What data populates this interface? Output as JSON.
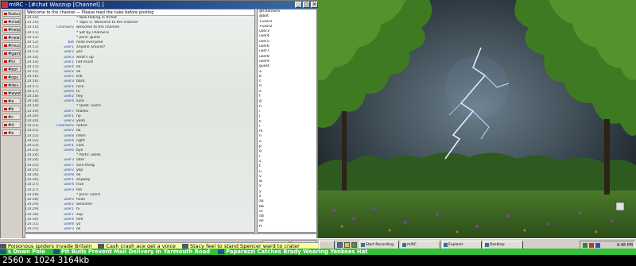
{
  "window": {
    "title": "mIRC - [#chat Wazzup [Channel] ]"
  },
  "switchbar": {
    "items": [
      "Status",
      "#chat",
      "#help",
      "#news",
      "#music",
      "#games",
      "#tv",
      "#bot",
      "#ops",
      "#dev",
      "#www",
      "#a",
      "#b",
      "#c",
      "#d",
      "#e"
    ]
  },
  "chat": {
    "topic": "Welcome to the channel — Please read the rules before posting",
    "lines": [
      {
        "ts": "[14:10]",
        "nick": "",
        "msg": "* Now talking in #chat"
      },
      {
        "ts": "[14:10]",
        "nick": "",
        "msg": "* Topic is 'Welcome to the channel'"
      },
      {
        "ts": "[14:10]",
        "nick": "ChanServ",
        "msg": "welcome to the channel"
      },
      {
        "ts": "[14:11]",
        "nick": "",
        "msg": "* Set by ChanServ"
      },
      {
        "ts": "[14:12]",
        "nick": "",
        "msg": "* Joins: guest"
      },
      {
        "ts": "[14:12]",
        "nick": "bot",
        "msg": "hello everyone"
      },
      {
        "ts": "[14:13]",
        "nick": "user1",
        "msg": "anyone around?"
      },
      {
        "ts": "[14:13]",
        "nick": "user2",
        "msg": "yes"
      },
      {
        "ts": "[14:14]",
        "nick": "user3",
        "msg": "what's up"
      },
      {
        "ts": "[14:14]",
        "nick": "user1",
        "msg": "not much"
      },
      {
        "ts": "[14:15]",
        "nick": "user4",
        "msg": "lol"
      },
      {
        "ts": "[14:15]",
        "nick": "user2",
        "msg": "ok"
      },
      {
        "ts": "[14:16]",
        "nick": "user5",
        "msg": "brb"
      },
      {
        "ts": "[14:16]",
        "nick": "user3",
        "msg": "back"
      },
      {
        "ts": "[14:17]",
        "nick": "user1",
        "msg": "nice"
      },
      {
        "ts": "[14:17]",
        "nick": "user6",
        "msg": "hi"
      },
      {
        "ts": "[14:18]",
        "nick": "user2",
        "msg": "hey"
      },
      {
        "ts": "[14:18]",
        "nick": "user4",
        "msg": "sure"
      },
      {
        "ts": "[14:19]",
        "nick": "",
        "msg": "* Quits: user5"
      },
      {
        "ts": "[14:19]",
        "nick": "user7",
        "msg": "thanks"
      },
      {
        "ts": "[14:20]",
        "nick": "user1",
        "msg": "np"
      },
      {
        "ts": "[14:20]",
        "nick": "user3",
        "msg": "yeah"
      },
      {
        "ts": "[14:21]",
        "nick": "ChanServ",
        "msg": "notice"
      },
      {
        "ts": "[14:21]",
        "nick": "user2",
        "msg": "ok"
      },
      {
        "ts": "[14:22]",
        "nick": "user8",
        "msg": "hmm"
      },
      {
        "ts": "[14:22]",
        "nick": "user4",
        "msg": "right"
      },
      {
        "ts": "[14:23]",
        "nick": "user1",
        "msg": "cool"
      },
      {
        "ts": "[14:23]",
        "nick": "user6",
        "msg": "bye"
      },
      {
        "ts": "[14:24]",
        "nick": "",
        "msg": "* Parts: user6"
      },
      {
        "ts": "[14:24]",
        "nick": "user3",
        "msg": "later"
      },
      {
        "ts": "[14:25]",
        "nick": "user7",
        "msg": "sure thing"
      },
      {
        "ts": "[14:25]",
        "nick": "user2",
        "msg": "yep"
      },
      {
        "ts": "[14:26]",
        "nick": "user8",
        "msg": "ok"
      },
      {
        "ts": "[14:26]",
        "nick": "user1",
        "msg": "anyway"
      },
      {
        "ts": "[14:27]",
        "nick": "user4",
        "msg": "true"
      },
      {
        "ts": "[14:27]",
        "nick": "user3",
        "msg": "hm"
      },
      {
        "ts": "[14:28]",
        "nick": "",
        "msg": "* Joins: user9"
      },
      {
        "ts": "[14:28]",
        "nick": "user9",
        "msg": "hello"
      },
      {
        "ts": "[14:29]",
        "nick": "user2",
        "msg": "welcome"
      },
      {
        "ts": "[14:29]",
        "nick": "user1",
        "msg": "hi"
      },
      {
        "ts": "[14:30]",
        "nick": "user7",
        "msg": "sup"
      },
      {
        "ts": "[14:30]",
        "nick": "user4",
        "msg": "heh"
      },
      {
        "ts": "[14:31]",
        "nick": "user8",
        "msg": "yo"
      },
      {
        "ts": "[14:31]",
        "nick": "user3",
        "msg": "ok"
      }
    ]
  },
  "nicklist": {
    "items": [
      "@ChanServ",
      "@bot",
      "+user1",
      "+user2",
      "user3",
      "user4",
      "user5",
      "user6",
      "user7",
      "user8",
      "user9",
      "guest",
      "a",
      "b",
      "c",
      "d",
      "e",
      "f",
      "g",
      "h",
      "i",
      "j",
      "k",
      "l",
      "m",
      "n",
      "o",
      "p",
      "q",
      "r",
      "s",
      "t",
      "u",
      "v",
      "w",
      "x",
      "y",
      "z",
      "aa",
      "bb",
      "cc",
      "dd",
      "ee",
      "ff"
    ]
  },
  "taskbar": {
    "start_label": "",
    "buttons": [
      {
        "label": "Start Recording"
      },
      {
        "label": "mIRC"
      },
      {
        "label": "Explorer"
      },
      {
        "label": "Desktop"
      }
    ],
    "clock": "9:48 PM"
  },
  "ticker_top": {
    "items": [
      "Poisonous spiders invade Britain",
      "Cash crash ace get a voice",
      "Stacy feel to stand Spencer ward to crater"
    ]
  },
  "ticker_bottom": {
    "items": [
      "s Down Pole",
      "Pit Bulls Prevent Mail Delivery In Yarmouth Road",
      "Paparazzi Catches Brady Wearing Yankees Hat"
    ]
  },
  "caption": {
    "text": "2560 x 1024 3164kb"
  },
  "colors": {
    "ticker_top_bg": "#fdfd9c",
    "ticker_bottom_bg": "#34c23a",
    "titlebar": "#0a246a"
  }
}
